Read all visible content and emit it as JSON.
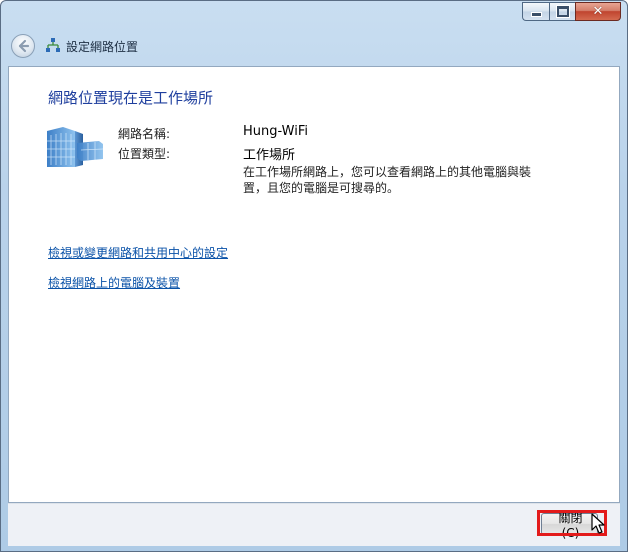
{
  "window": {
    "title": "設定網路位置",
    "caption_buttons": [
      "minimize-icon",
      "maximize-icon",
      "close-icon"
    ]
  },
  "content": {
    "heading": "網路位置現在是工作場所",
    "fields": [
      {
        "label": "網路名稱:",
        "value": "Hung-WiFi"
      },
      {
        "label": "位置類型:",
        "value": "工作場所"
      }
    ],
    "description": "在工作場所網路上，您可以查看網路上的其他電腦與裝置，且您的電腦是可搜尋的。",
    "links": [
      "檢視或變更網路和共用中心的設定",
      "檢視網路上的電腦及裝置"
    ]
  },
  "footer": {
    "close_label": "關閉(C)"
  },
  "colors": {
    "heading": "#1f3f9e",
    "link": "#0a52a8",
    "highlight": "#e31b1b"
  },
  "icons": [
    "back-arrow-icon",
    "network-icon",
    "building-icon",
    "cursor-icon"
  ]
}
